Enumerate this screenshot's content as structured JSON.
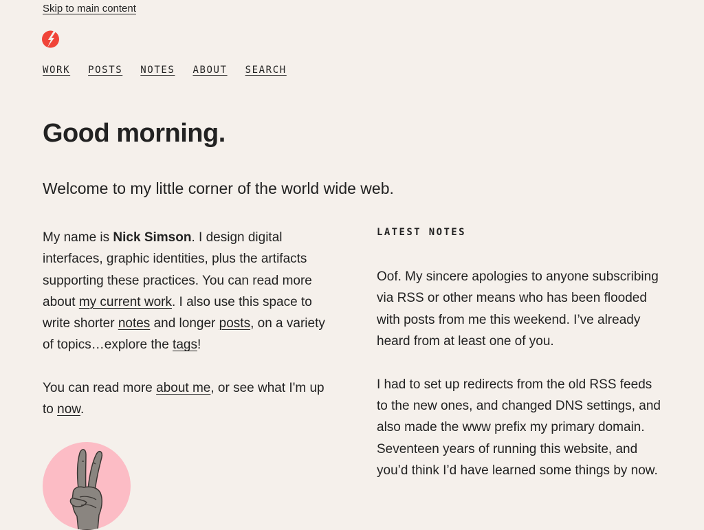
{
  "skip_link": "Skip to main content",
  "brand": {
    "accent": "#f04438",
    "logo_icon": "lightning-circle-icon"
  },
  "nav": {
    "items": [
      {
        "label": "WORK"
      },
      {
        "label": "POSTS"
      },
      {
        "label": "NOTES"
      },
      {
        "label": "ABOUT"
      },
      {
        "label": "SEARCH"
      }
    ]
  },
  "main": {
    "greeting": "Good morning.",
    "intro": "Welcome to my little corner of the world wide web.",
    "bio": {
      "p1_a": "My name is ",
      "name": "Nick Simson",
      "p1_b": ". I design digital interfaces, graphic identities, plus the artifacts supporting these practices. You can read more about ",
      "link_work": "my current work",
      "p1_c": ". I also use this space to write shorter ",
      "link_notes": "notes",
      "p1_d": " and longer ",
      "link_posts": "posts",
      "p1_e": ", on a variety of topics…explore the ",
      "link_tags": "tags",
      "p1_f": "!",
      "p2_a": "You can read more ",
      "link_about": "about me",
      "p2_b": ", or see what I'm up to ",
      "link_now": "now",
      "p2_c": "."
    },
    "avatar_icon": "peace-hand-icon",
    "avatar_bg": "#fcbcc5"
  },
  "latest_notes": {
    "label": "LATEST NOTES",
    "paragraphs": [
      "Oof. My sincere apologies to anyone subscribing via RSS or other means who has been flooded with posts from me this weekend. I’ve already heard from at least one of you.",
      "I had to set up redirects from the old RSS feeds to the new ones, and changed DNS settings, and also made the www prefix my primary domain. Seventeen years of running this website, and you’d think I’d have learned some things by now."
    ]
  }
}
